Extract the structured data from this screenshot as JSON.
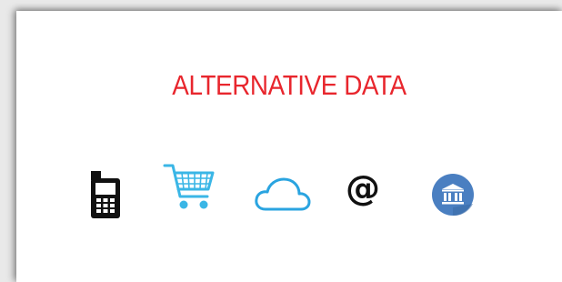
{
  "title": "ALTERNATIVE DATA",
  "colors": {
    "title": "#e8262d",
    "phone": "#111111",
    "cart": "#3ab6e6",
    "cloud": "#2aa4e0",
    "bank_bg": "#4a7fc1",
    "bank_fg": "#ffffff"
  },
  "icons": [
    {
      "name": "mobile-phone-icon"
    },
    {
      "name": "shopping-cart-icon"
    },
    {
      "name": "cloud-icon"
    },
    {
      "name": "at-sign-icon",
      "glyph": "@"
    },
    {
      "name": "bank-icon"
    }
  ]
}
